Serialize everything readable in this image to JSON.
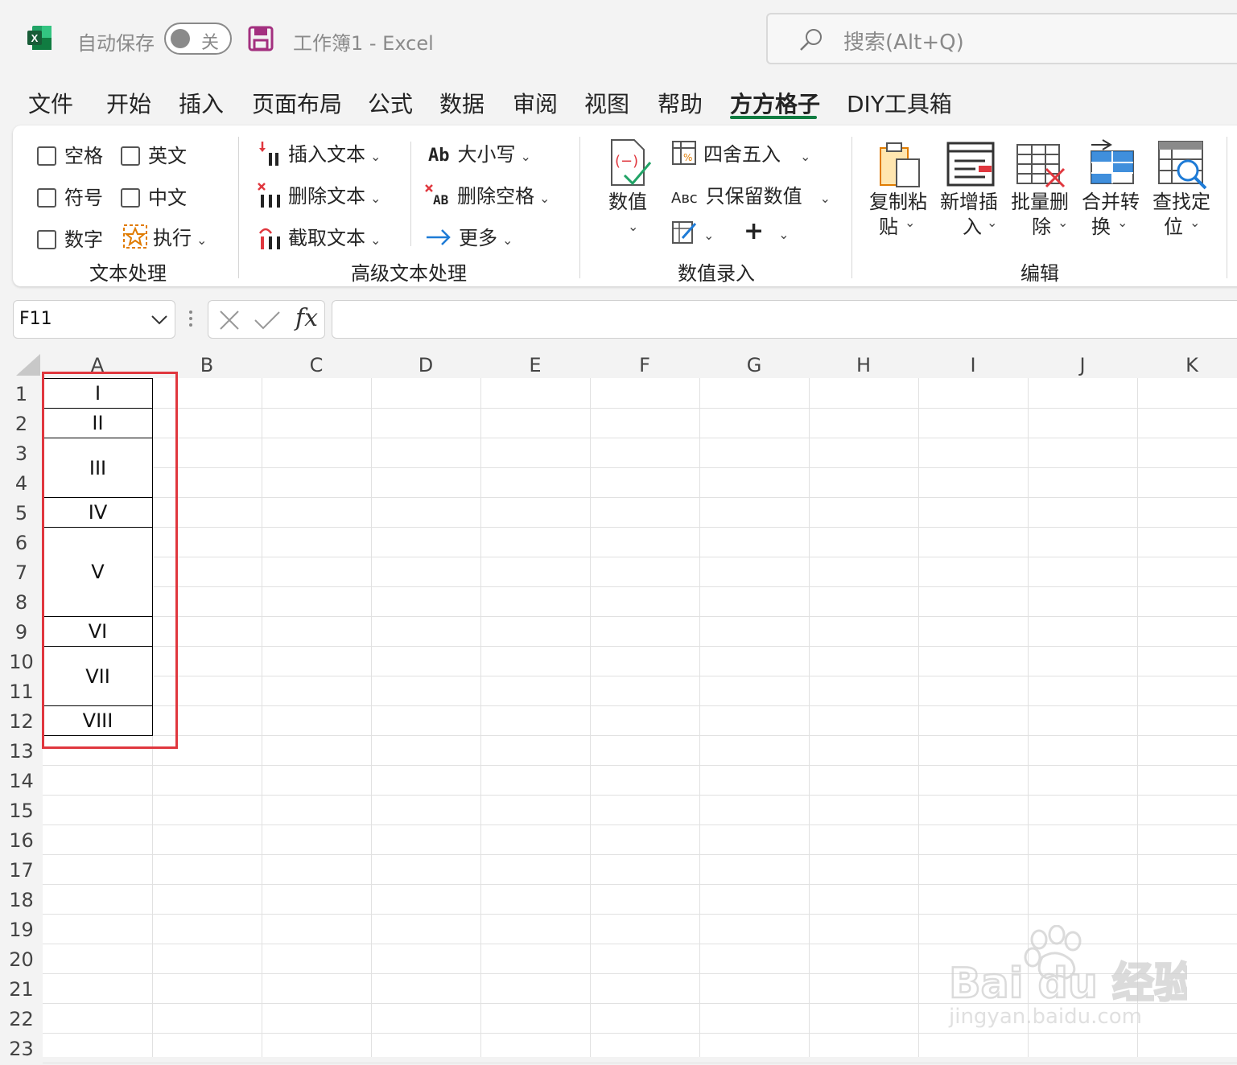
{
  "titlebar": {
    "autosave_label": "自动保存",
    "autosave_state": "关",
    "workbook_title": "工作簿1  -  Excel",
    "search_placeholder": "搜索(Alt+Q)"
  },
  "menu": {
    "tabs": [
      "文件",
      "开始",
      "插入",
      "页面布局",
      "公式",
      "数据",
      "审阅",
      "视图",
      "帮助",
      "方方格子",
      "DIY工具箱"
    ],
    "active_tab": "方方格子"
  },
  "ribbon": {
    "text_processing": {
      "checks": [
        "空格",
        "英文",
        "符号",
        "中文",
        "数字"
      ],
      "execute_label": "执行",
      "group_label": "文本处理"
    },
    "advanced_text": {
      "insert_text": "插入文本",
      "delete_text": "删除文本",
      "extract_text": "截取文本",
      "case_label": "大小写",
      "delete_space": "删除空格",
      "more_label": "更多",
      "group_label": "高级文本处理"
    },
    "numeric_entry": {
      "numeric_label": "数值",
      "round_label": "四舍五入",
      "keep_numeric": "只保留数值",
      "group_label": "数值录入"
    },
    "edit": {
      "copy_paste": [
        "复制粘",
        "贴"
      ],
      "new_insert": [
        "新增插",
        "入"
      ],
      "batch_delete": [
        "批量删",
        "除"
      ],
      "merge_convert": [
        "合并转",
        "换"
      ],
      "find_locate": [
        "查找定",
        "位"
      ],
      "group_label": "编辑"
    }
  },
  "formula_bar": {
    "cell_ref": "F11",
    "formula": ""
  },
  "sheet": {
    "columns": [
      "A",
      "B",
      "C",
      "D",
      "E",
      "F",
      "G",
      "H",
      "I",
      "J",
      "K"
    ],
    "rows": [
      "1",
      "2",
      "3",
      "4",
      "5",
      "6",
      "7",
      "8",
      "9",
      "10",
      "11",
      "12",
      "13",
      "14",
      "15",
      "16",
      "17",
      "18",
      "19",
      "20",
      "21",
      "22",
      "23"
    ],
    "merged_cells_A": [
      "I",
      "II",
      "III",
      "IV",
      "V",
      "VI",
      "VII",
      "VIII"
    ]
  },
  "colors": {
    "excel_green": "#107c41",
    "highlight_red": "#e0373e"
  },
  "watermark": {
    "brand": "Bai du 经验",
    "url": "jingyan.baidu.com"
  }
}
